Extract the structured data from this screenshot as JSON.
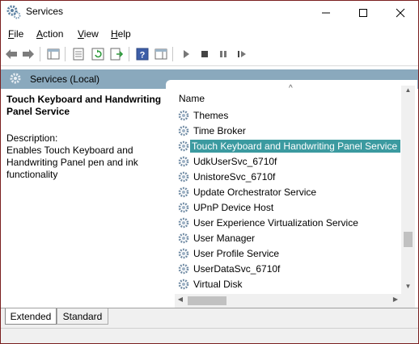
{
  "window": {
    "title": "Services"
  },
  "menu": [
    {
      "label": "File"
    },
    {
      "label": "Action"
    },
    {
      "label": "View"
    },
    {
      "label": "Help"
    }
  ],
  "header": {
    "title": "Services (Local)"
  },
  "details": {
    "service_name": "Touch Keyboard and Handwriting Panel Service",
    "description_label": "Description:",
    "description": "Enables Touch Keyboard and Handwriting Panel pen and ink functionality"
  },
  "list": {
    "column_name": "Name",
    "rows": [
      {
        "name": "Themes"
      },
      {
        "name": "Time Broker"
      },
      {
        "name": "Touch Keyboard and Handwriting Panel Service",
        "selected": true
      },
      {
        "name": "UdkUserSvc_6710f"
      },
      {
        "name": "UnistoreSvc_6710f"
      },
      {
        "name": "Update Orchestrator Service"
      },
      {
        "name": "UPnP Device Host"
      },
      {
        "name": "User Experience Virtualization Service"
      },
      {
        "name": "User Manager"
      },
      {
        "name": "User Profile Service"
      },
      {
        "name": "UserDataSvc_6710f"
      },
      {
        "name": "Virtual Disk"
      }
    ]
  },
  "tabs": [
    {
      "label": "Extended"
    },
    {
      "label": "Standard"
    }
  ],
  "colors": {
    "accent_selection": "#3b9aa0",
    "header_strip": "#8aa9bd"
  }
}
